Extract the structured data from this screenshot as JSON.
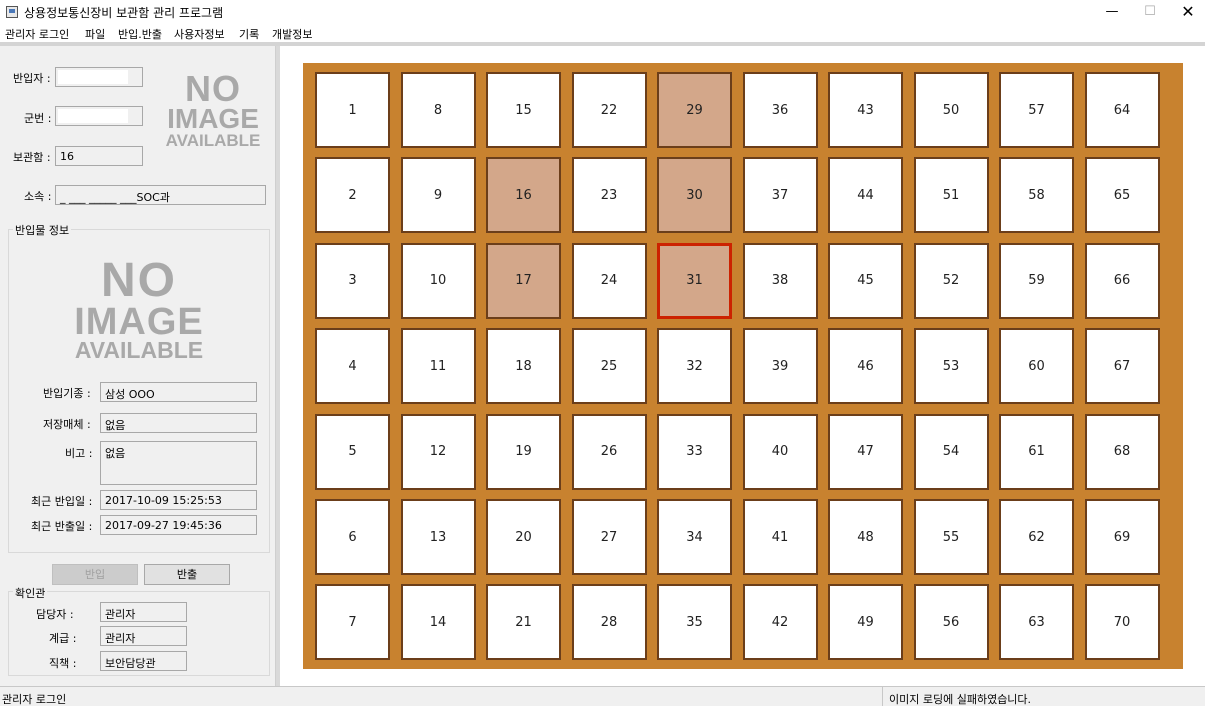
{
  "window": {
    "title": "상용정보통신장비 보관함 관리 프로그램",
    "min": "—",
    "max": "☐",
    "close": "✕"
  },
  "menu": [
    "관리자 로그인",
    "파일",
    "반입.반출",
    "사용자정보",
    "기록",
    "개발정보"
  ],
  "user": {
    "bringer_label": "반입자 :",
    "service_no_label": "군번 :",
    "locker_label": "보관함 :",
    "locker_value": "16",
    "affiliation_label": "소속 :",
    "affiliation_value": "_ ___ _____ ___SOC과"
  },
  "no_image": {
    "line1": "NO",
    "line2": "IMAGE",
    "line3": "AVAILABLE"
  },
  "item_info": {
    "group_title": "반입물 정보",
    "model_label": "반입기종 :",
    "model_value": "삼성 OOO",
    "storage_label": "저장매체 :",
    "storage_value": "없음",
    "note_label": "비고 :",
    "note_value": "없음",
    "last_in_label": "최근 반입일 :",
    "last_in_value": "2017-10-09 15:25:53",
    "last_out_label": "최근 반출일 :",
    "last_out_value": "2017-09-27 19:45:36"
  },
  "buttons": {
    "bring_in": "반입",
    "take_out": "반출"
  },
  "confirmer": {
    "group_title": "확인관",
    "manager_label": "담당자 :",
    "manager_value": "관리자",
    "rank_label": "계급 :",
    "rank_value": "관리자",
    "position_label": "직책 :",
    "position_value": "보안담당관"
  },
  "cabinet": {
    "columns": 10,
    "rows": 7,
    "cells": [
      1,
      2,
      3,
      4,
      5,
      6,
      7,
      8,
      9,
      10,
      11,
      12,
      13,
      14,
      15,
      16,
      17,
      18,
      19,
      20,
      21,
      22,
      23,
      24,
      25,
      26,
      27,
      28,
      29,
      30,
      31,
      32,
      33,
      34,
      35,
      36,
      37,
      38,
      39,
      40,
      41,
      42,
      43,
      44,
      45,
      46,
      47,
      48,
      49,
      50,
      51,
      52,
      53,
      54,
      55,
      56,
      57,
      58,
      59,
      60,
      61,
      62,
      63,
      64,
      65,
      66,
      67,
      68,
      69,
      70
    ],
    "occupied": [
      16,
      17,
      29,
      30,
      31
    ],
    "selected": 31,
    "colors": {
      "frame": "#c8822f",
      "occupied": "#d3a78a",
      "selected_border": "#cc2200",
      "empty": "#ffffff"
    }
  },
  "status": {
    "left": "관리자 로그인",
    "right": "이미지 로딩에 실패하였습니다."
  }
}
